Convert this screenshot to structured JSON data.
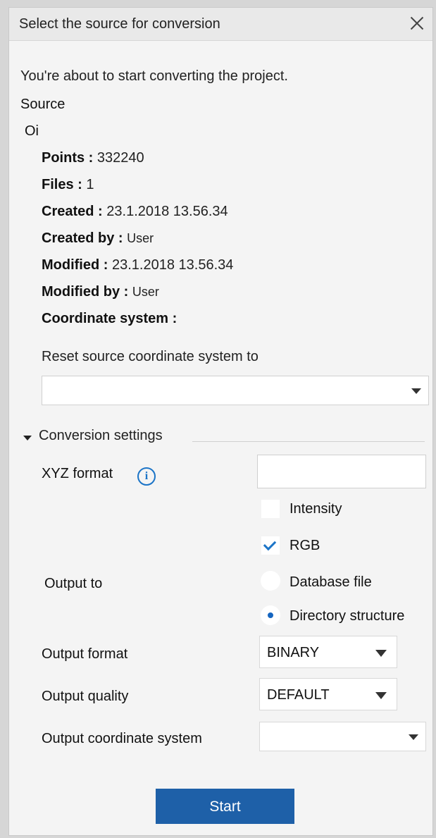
{
  "dialog": {
    "title": "Select the source for conversion",
    "intro": "You're about to start converting the project.",
    "source_header": "Source",
    "source_name": "Oi",
    "fields": [
      {
        "label": "Points :",
        "value": "332240"
      },
      {
        "label": "Files :",
        "value": "1"
      },
      {
        "label": "Created :",
        "value": "23.1.2018 13.56.34"
      },
      {
        "label": "Created by :",
        "value": "User"
      },
      {
        "label": "Modified :",
        "value": "23.1.2018 13.56.34"
      },
      {
        "label": "Modified by :",
        "value": "User"
      },
      {
        "label": "Coordinate system :",
        "value": ""
      }
    ],
    "reset_label": "Reset source coordinate system to",
    "reset_value": ""
  },
  "conversion": {
    "section_label": "Conversion settings",
    "xyz_label": "XYZ format",
    "xyz_value": "",
    "intensity_label": "Intensity",
    "intensity_checked": false,
    "rgb_label": "RGB",
    "rgb_checked": true,
    "output_to_label": "Output to",
    "database_label": "Database file",
    "directory_label": "Directory structure",
    "output_to_selected": "Directory structure",
    "output_format_label": "Output format",
    "output_format_value": "BINARY",
    "output_quality_label": "Output quality",
    "output_quality_value": "DEFAULT",
    "output_cs_label": "Output coordinate system",
    "output_cs_value": ""
  },
  "actions": {
    "start_label": "Start"
  },
  "colors": {
    "accent": "#1b74c7",
    "start_button": "#1e60a8"
  }
}
